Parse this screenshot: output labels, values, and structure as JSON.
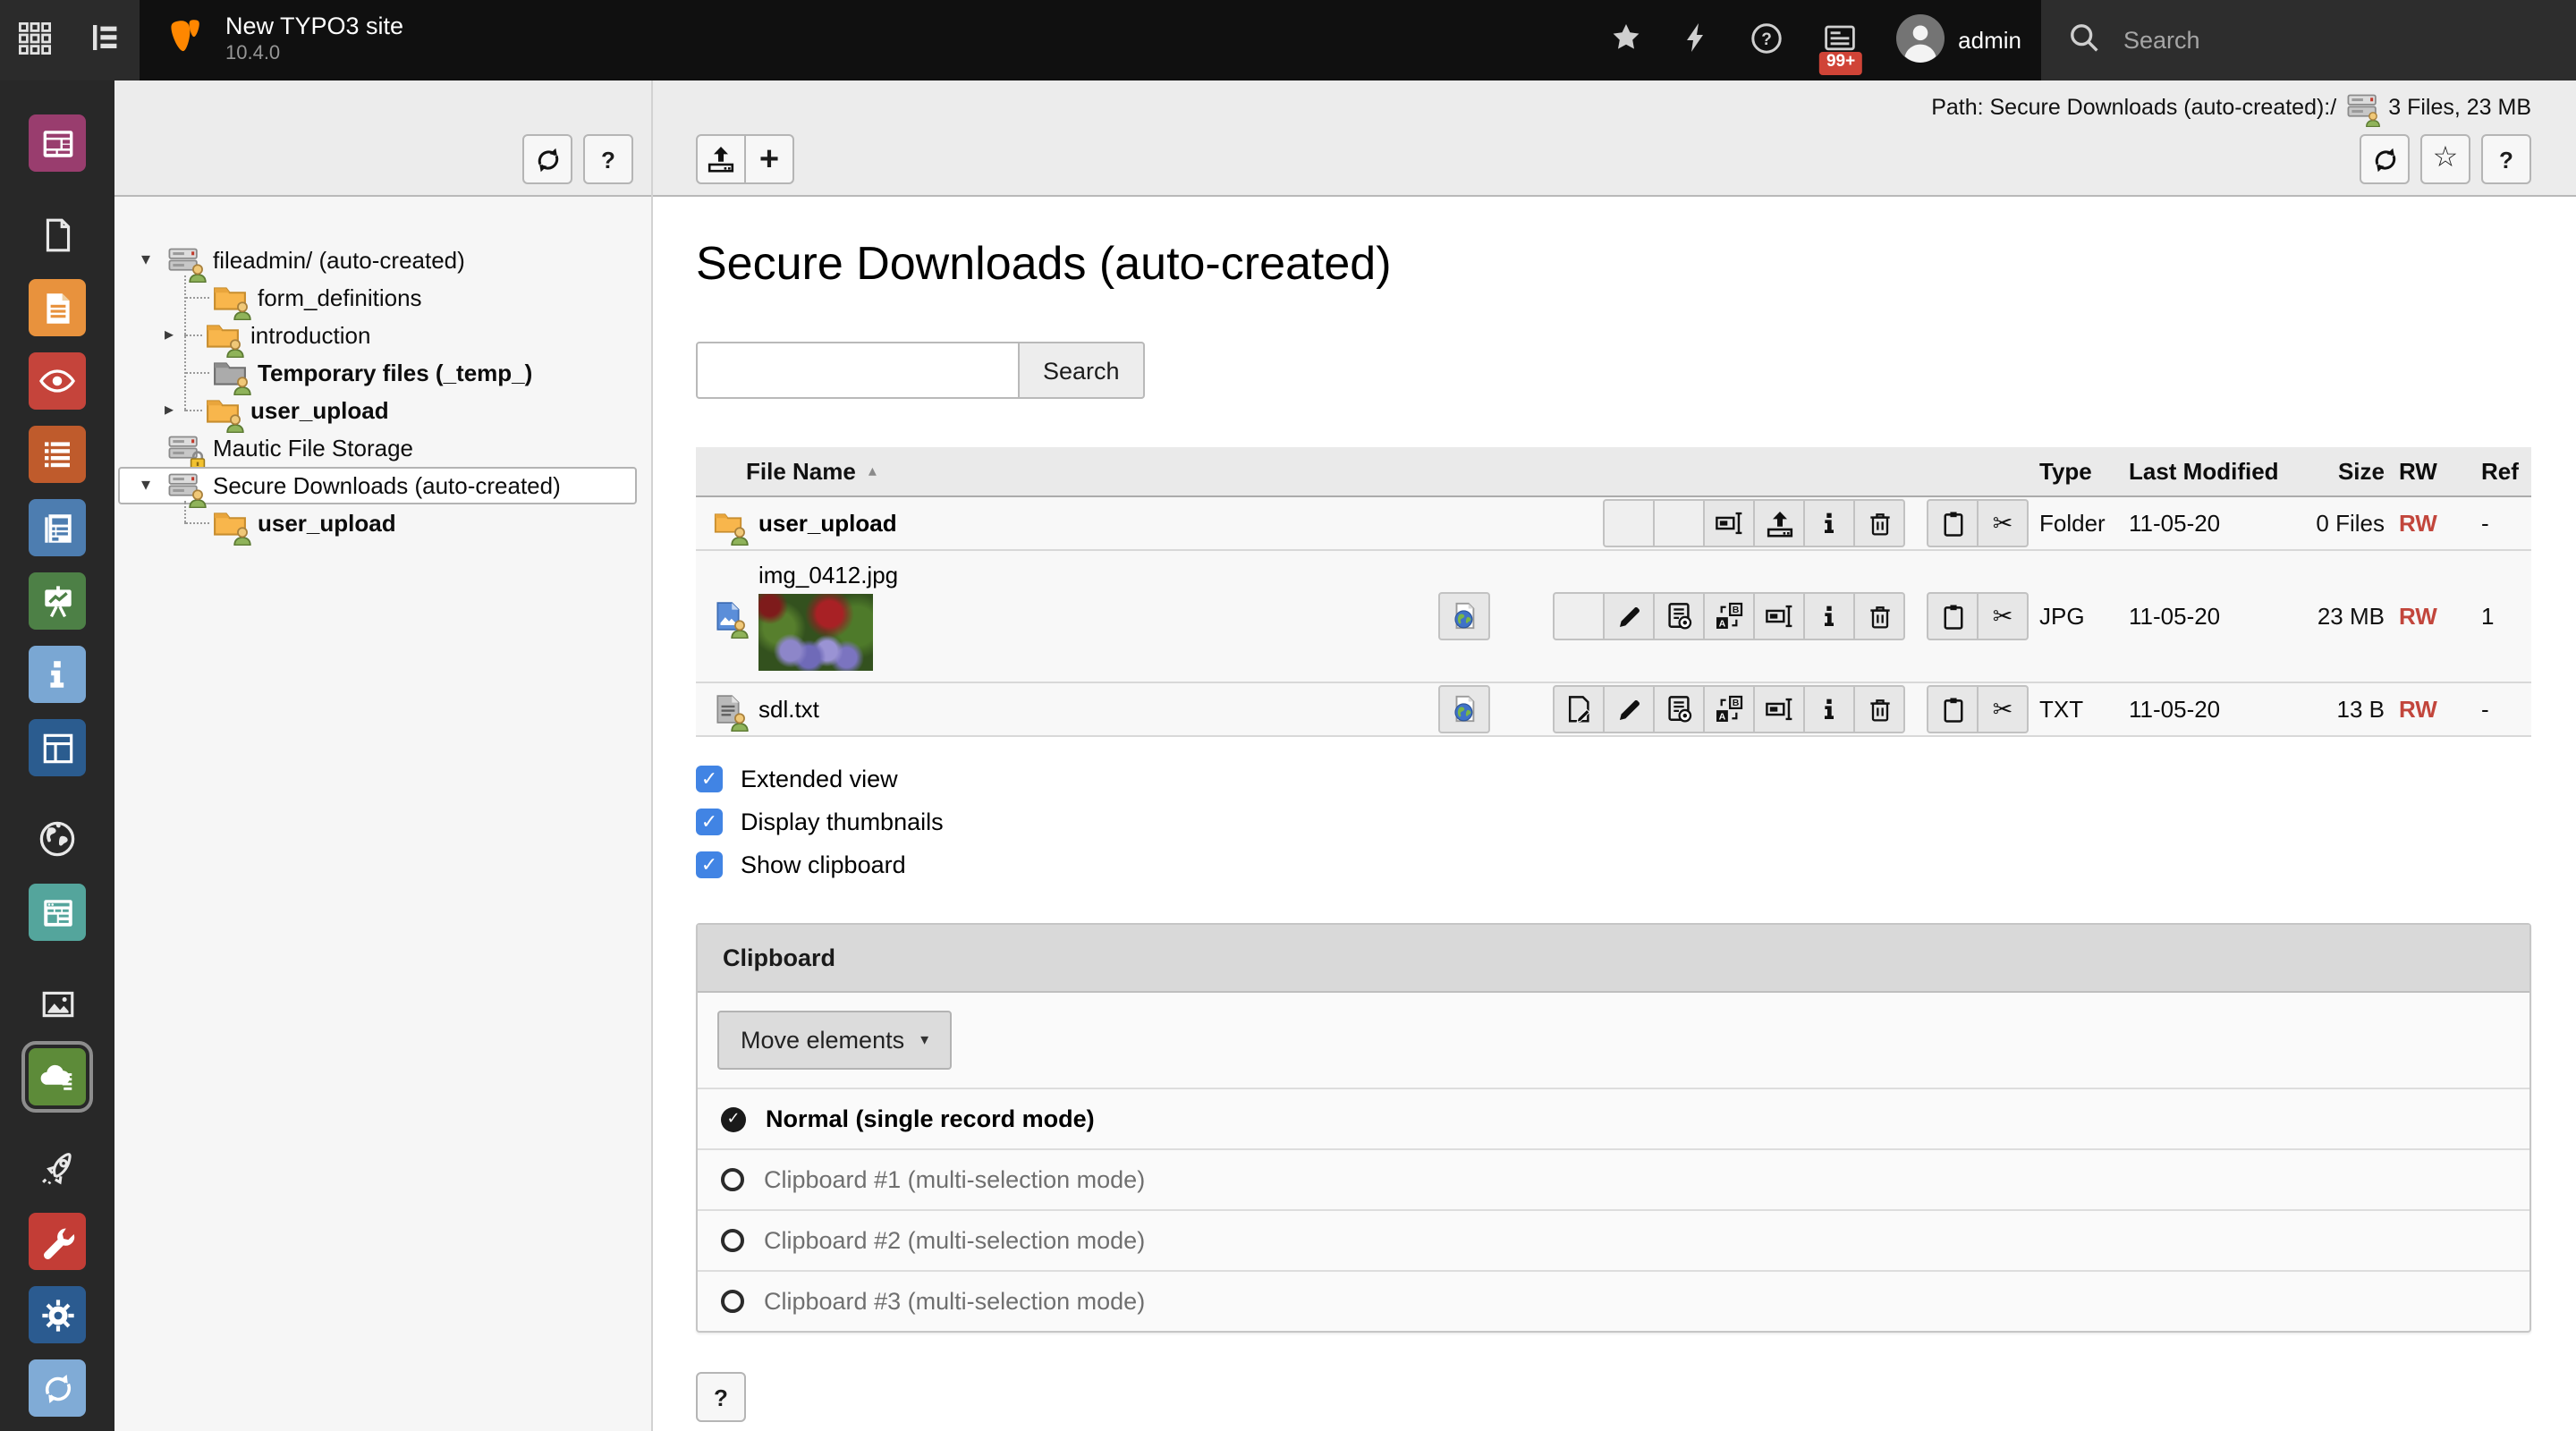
{
  "topbar": {
    "site_title": "New TYPO3 site",
    "version": "10.4.0",
    "username": "admin",
    "search_placeholder": "Search",
    "notification_badge": "99+"
  },
  "ui": {
    "help_label": "?"
  },
  "module_bar": {
    "active_module": "secure-downloads",
    "modules": [
      {
        "name": "dashboard",
        "icon": "m-dashboard",
        "color": "#993d6e",
        "group": 0,
        "active": false
      },
      {
        "name": "page",
        "icon": "m-page",
        "color": "",
        "group": 1,
        "active": false
      },
      {
        "name": "content",
        "icon": "m-doclines",
        "color": "#e8923d",
        "group": 1,
        "active": false
      },
      {
        "name": "view",
        "icon": "m-eye",
        "color": "#c5443b",
        "group": 1,
        "active": false
      },
      {
        "name": "list",
        "icon": "m-list",
        "color": "#bf5b2c",
        "group": 1,
        "active": false
      },
      {
        "name": "info",
        "icon": "m-news",
        "color": "#4d7db0",
        "group": 1,
        "active": false
      },
      {
        "name": "template",
        "icon": "m-easel",
        "color": "#4d8046",
        "group": 1,
        "active": false
      },
      {
        "name": "about",
        "icon": "m-i",
        "color": "#7aa7d3",
        "group": 1,
        "active": false
      },
      {
        "name": "workspaces",
        "icon": "m-frame",
        "color": "#2b5c8f",
        "group": 1,
        "active": false
      },
      {
        "name": "sites",
        "icon": "m-globe",
        "color": "",
        "group": 2,
        "active": false
      },
      {
        "name": "forms",
        "icon": "m-forms",
        "color": "#54a59c",
        "group": 2,
        "active": false
      },
      {
        "name": "filelist",
        "icon": "m-image",
        "color": "",
        "group": 3,
        "active": false
      },
      {
        "name": "secure-downloads",
        "icon": "m-cloud",
        "color": "#5d8b39",
        "group": 3,
        "active": true
      },
      {
        "name": "upgrade",
        "icon": "m-rocket",
        "color": "",
        "group": 4,
        "active": false
      },
      {
        "name": "maintenance",
        "icon": "m-wrench",
        "color": "#c33d36",
        "group": 4,
        "active": false
      },
      {
        "name": "settings",
        "icon": "m-gear",
        "color": "#2b5b90",
        "group": 4,
        "active": false
      },
      {
        "name": "environment",
        "icon": "m-sync",
        "color": "#80abd6",
        "group": 4,
        "active": false
      }
    ]
  },
  "file_tree": {
    "nodes": [
      {
        "label": "fileadmin/ (auto-created)",
        "depth": 0,
        "icon": "storage",
        "caret": "open",
        "bold": false,
        "selected": false
      },
      {
        "label": "form_definitions",
        "depth": 1,
        "icon": "folder",
        "caret": null,
        "bold": false,
        "selected": false
      },
      {
        "label": "introduction",
        "depth": 1,
        "icon": "folder",
        "caret": "closed",
        "bold": false,
        "selected": false
      },
      {
        "label": "Temporary files (_temp_)",
        "depth": 1,
        "icon": "folder-grey",
        "caret": null,
        "bold": true,
        "selected": false
      },
      {
        "label": "user_upload",
        "depth": 1,
        "icon": "folder",
        "caret": "closed",
        "bold": true,
        "selected": false
      },
      {
        "label": "Mautic File Storage",
        "depth": 0,
        "icon": "storage-lock",
        "caret": null,
        "bold": false,
        "selected": false
      },
      {
        "label": "Secure Downloads (auto-created)",
        "depth": 0,
        "icon": "storage",
        "caret": "open",
        "bold": false,
        "selected": true
      },
      {
        "label": "user_upload",
        "depth": 1,
        "icon": "folder",
        "caret": null,
        "bold": true,
        "selected": false
      }
    ]
  },
  "docheader": {
    "path_label": "Path: Secure Downloads (auto-created):/",
    "path_info": "3 Files, 23 MB"
  },
  "content": {
    "title": "Secure Downloads (auto-created)",
    "search_value": "",
    "search_button_label": "Search"
  },
  "file_table": {
    "columns": [
      "File Name",
      "Type",
      "Last Modified",
      "Size",
      "RW",
      "Ref"
    ],
    "sort_column": "File Name",
    "sort_direction": "asc",
    "rows": [
      {
        "name": "user_upload",
        "icon": "folder",
        "bold": true,
        "thumbnail": false,
        "type": "Folder",
        "modified": "11-05-20",
        "size": "0 Files",
        "rw": "RW",
        "ref": "-",
        "view": false,
        "actions": [
          "blank",
          "blank",
          "rename",
          "upload",
          "info",
          "delete"
        ],
        "clipboard": [
          "copy",
          "cut"
        ]
      },
      {
        "name": "img_0412.jpg",
        "icon": "image-file",
        "bold": false,
        "thumbnail": true,
        "type": "JPG",
        "modified": "11-05-20",
        "size": "23 MB",
        "rw": "RW",
        "ref": "1",
        "view": true,
        "actions": [
          "blank",
          "edit",
          "metadata",
          "translate",
          "rename",
          "info",
          "delete"
        ],
        "clipboard": [
          "copy",
          "cut"
        ]
      },
      {
        "name": "sdl.txt",
        "icon": "text-file",
        "bold": false,
        "thumbnail": false,
        "type": "TXT",
        "modified": "11-05-20",
        "size": "13 B",
        "rw": "RW",
        "ref": "-",
        "view": true,
        "actions": [
          "editsource",
          "edit",
          "metadata",
          "translate",
          "rename",
          "info",
          "delete"
        ],
        "clipboard": [
          "copy",
          "cut"
        ]
      }
    ]
  },
  "view_options": [
    {
      "label": "Extended view",
      "checked": true
    },
    {
      "label": "Display thumbnails",
      "checked": true
    },
    {
      "label": "Show clipboard",
      "checked": true
    }
  ],
  "clipboard_panel": {
    "title": "Clipboard",
    "menu_button_label": "Move elements",
    "items": [
      {
        "label": "Normal (single record mode)",
        "selected": true
      },
      {
        "label": "Clipboard #1 (multi-selection mode)",
        "selected": false
      },
      {
        "label": "Clipboard #2 (multi-selection mode)",
        "selected": false
      },
      {
        "label": "Clipboard #3 (multi-selection mode)",
        "selected": false
      }
    ]
  }
}
